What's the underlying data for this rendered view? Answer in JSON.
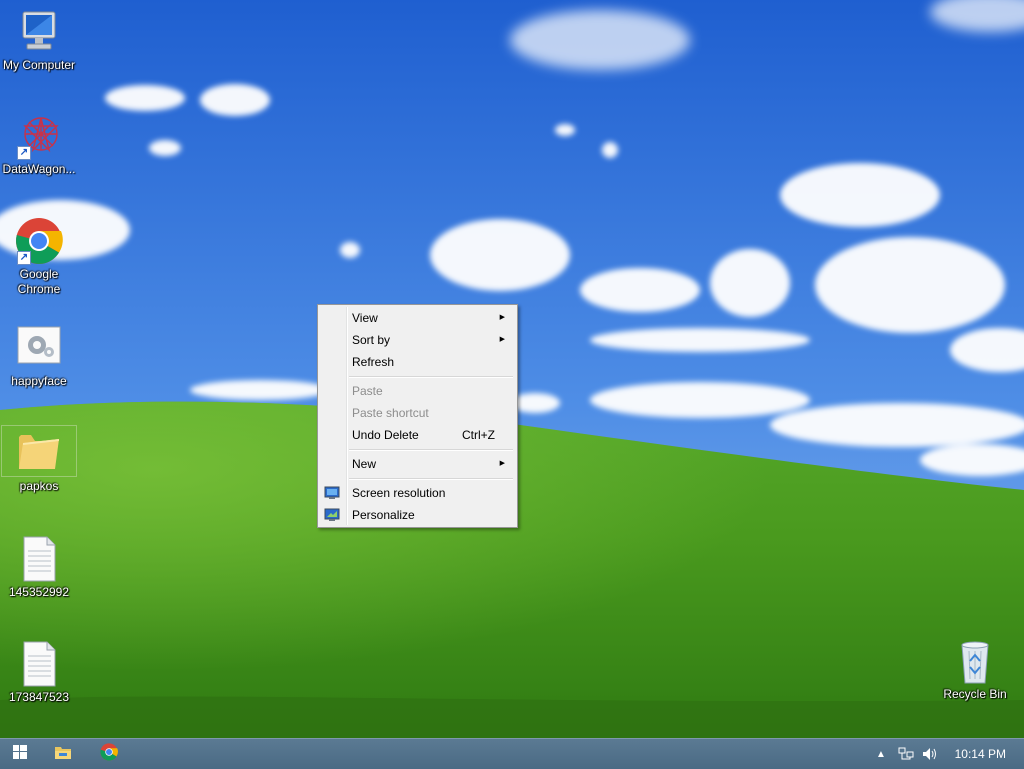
{
  "desktop": {
    "icons": [
      {
        "label": "My Computer",
        "icon": "computer-icon"
      },
      {
        "label": "DataWagon...",
        "icon": "datawagon-icon"
      },
      {
        "label": "Google Chrome",
        "icon": "chrome-icon"
      },
      {
        "label": "happyface",
        "icon": "settings-file-icon"
      },
      {
        "label": "papkos",
        "icon": "folder-icon"
      },
      {
        "label": "145352992",
        "icon": "text-file-icon"
      },
      {
        "label": "173847523",
        "icon": "text-file-icon"
      },
      {
        "label": "Recycle Bin",
        "icon": "recycle-bin-icon"
      }
    ]
  },
  "context_menu": {
    "items": [
      {
        "label": "View",
        "submenu": true,
        "enabled": true
      },
      {
        "label": "Sort by",
        "submenu": true,
        "enabled": true
      },
      {
        "label": "Refresh",
        "enabled": true
      },
      {
        "label": "Paste",
        "enabled": false
      },
      {
        "label": "Paste shortcut",
        "enabled": false
      },
      {
        "label": "Undo Delete",
        "shortcut": "Ctrl+Z",
        "enabled": true
      },
      {
        "label": "New",
        "submenu": true,
        "enabled": true
      },
      {
        "label": "Screen resolution",
        "icon": "screen-resolution-icon",
        "enabled": true
      },
      {
        "label": "Personalize",
        "icon": "personalize-icon",
        "enabled": true
      }
    ]
  },
  "taskbar": {
    "start_icon": "windows-start-icon",
    "pinned": [
      "file-explorer-icon",
      "chrome-icon"
    ],
    "tray": [
      "show-hidden-icons-icon",
      "network-icon",
      "volume-icon"
    ],
    "clock": "10:14 PM"
  },
  "colors": {
    "sky": "#2f6fd6",
    "grass": "#4f9a22",
    "taskbar": "#4f6f88",
    "menu_bg": "#f0f0f0"
  }
}
